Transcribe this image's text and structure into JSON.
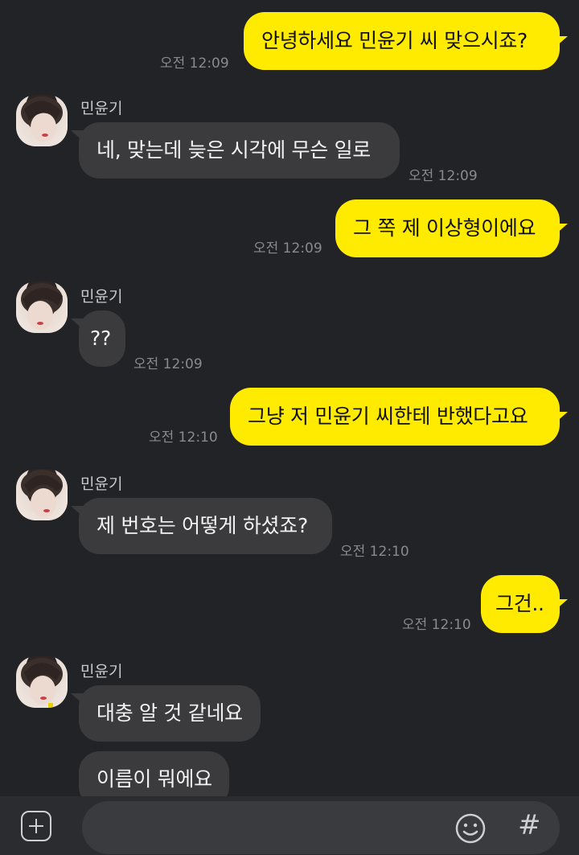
{
  "messages": [
    {
      "side": "me",
      "text": "안녕하세요 민윤기 씨 맞으시죠?",
      "time": "오전 12:09"
    },
    {
      "side": "them",
      "name": "민윤기",
      "text": "네, 맞는데 늦은 시각에 무슨 일로",
      "time": "오전 12:09"
    },
    {
      "side": "me",
      "text": "그 쪽 제 이상형이에요",
      "time": "오전 12:09"
    },
    {
      "side": "them",
      "name": "민윤기",
      "text": "??",
      "time": "오전 12:09"
    },
    {
      "side": "me",
      "text": "그냥 저 민윤기 씨한테 반했다고요",
      "time": "오전 12:10"
    },
    {
      "side": "them",
      "name": "민윤기",
      "text": "제 번호는 어떻게 하셨죠?",
      "time": "오전 12:10"
    },
    {
      "side": "me",
      "text": "그건..",
      "time": "오전 12:10"
    },
    {
      "side": "them",
      "name": "민윤기",
      "text": "대충 알 것 같네요"
    },
    {
      "side": "them",
      "text": "이름이 뭐에요"
    }
  ],
  "input": {
    "placeholder": "",
    "plus_icon": "plus-square-icon",
    "emoji_icon": "smiley-icon",
    "hash_label": "#"
  },
  "colors": {
    "background": "#222326",
    "my_bubble": "#ffeb00",
    "their_bubble": "#3b3b3e",
    "timestamp": "#8a8a8e"
  }
}
